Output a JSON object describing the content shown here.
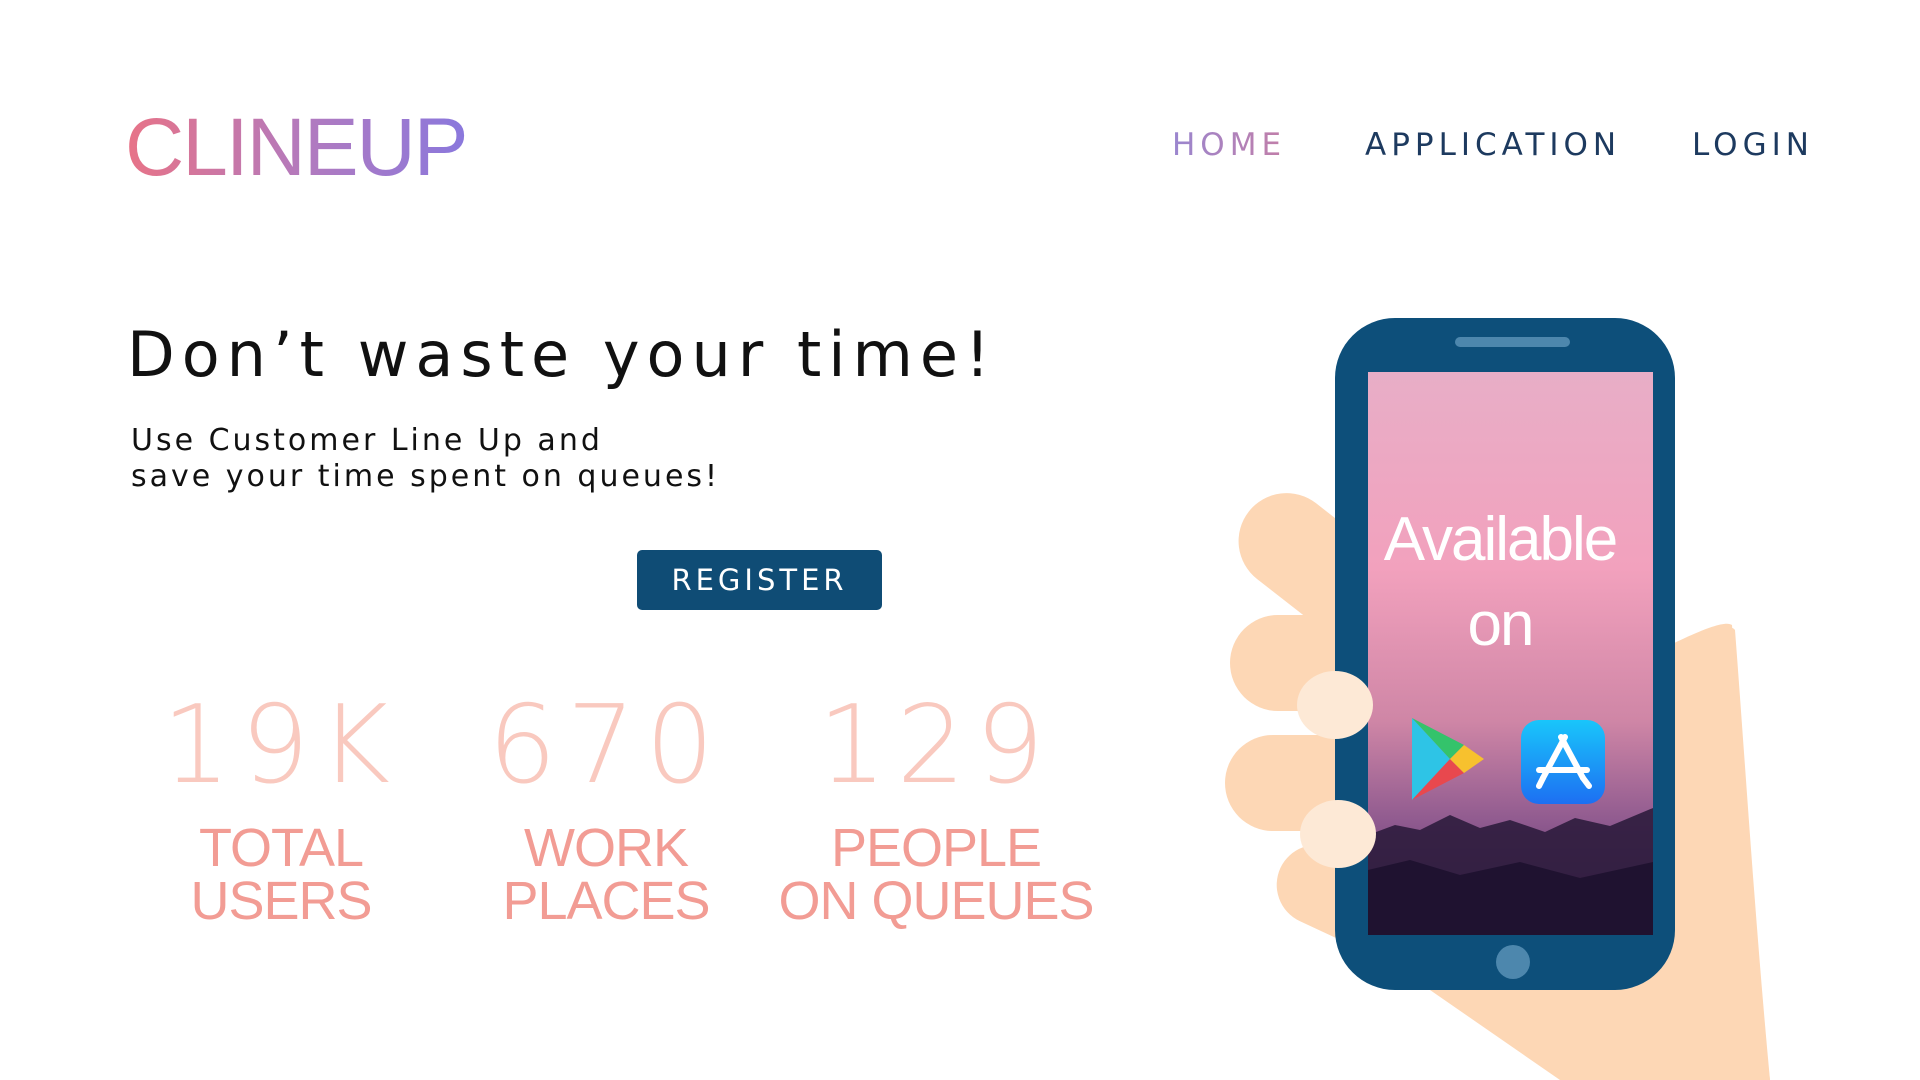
{
  "header": {
    "logo": "CLINEUP",
    "nav": [
      {
        "label": "HOME",
        "active": true
      },
      {
        "label": "APPLICATION",
        "active": false
      },
      {
        "label": "LOGIN",
        "active": false
      }
    ]
  },
  "hero": {
    "headline": "Don’t waste your time!",
    "subline_1": "Use Customer Line Up and",
    "subline_2": "save your time spent on queues!",
    "register_label": "REGISTER"
  },
  "stats": [
    {
      "value": "19K",
      "label_line1": "TOTAL",
      "label_line2": "USERS"
    },
    {
      "value": "670",
      "label_line1": "WORK",
      "label_line2": "PLACES"
    },
    {
      "value": "129",
      "label_line1": "PEOPLE",
      "label_line2": "ON QUEUES"
    }
  ],
  "phone": {
    "line1": "Available",
    "line2": "on",
    "icons": [
      "google-play-icon",
      "app-store-icon"
    ]
  },
  "colors": {
    "primary": "#0f4c75",
    "phone_body": "#0d4f7a",
    "stat_value": "#f9c9bf",
    "stat_label": "#f29c94",
    "logo_start": "#e87387",
    "logo_end": "#8a78dd",
    "skin": "#fdd7b5"
  }
}
